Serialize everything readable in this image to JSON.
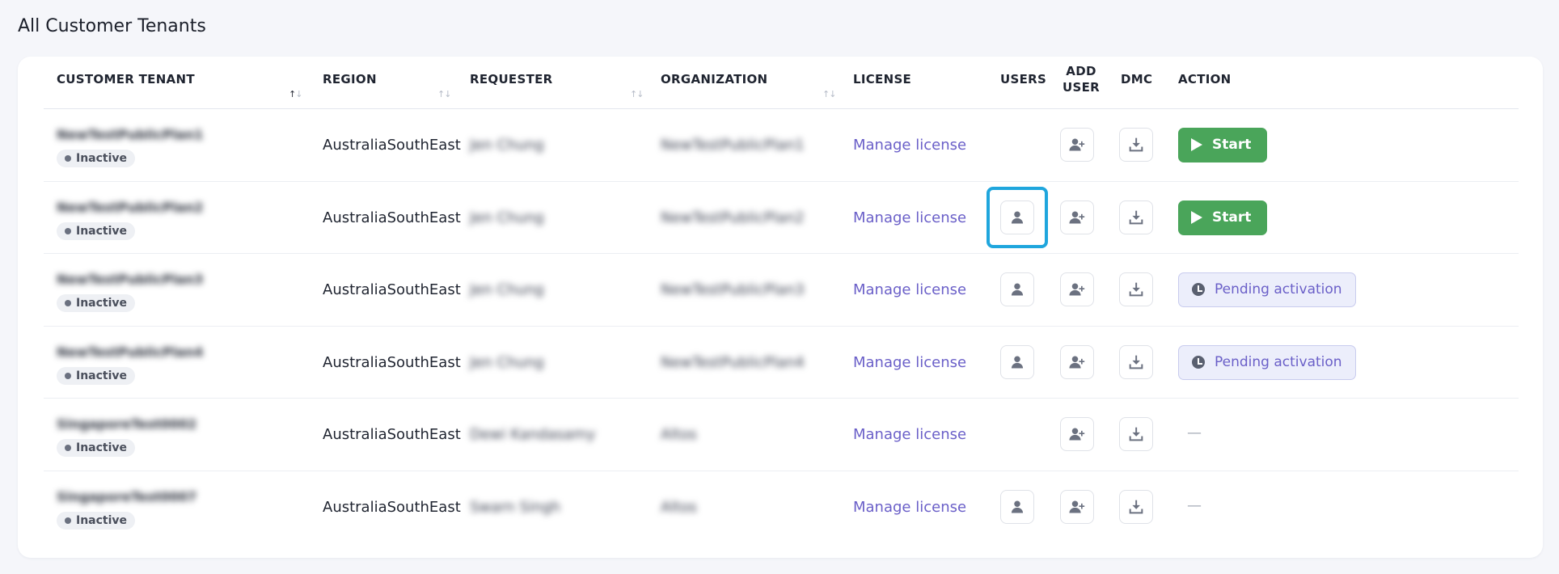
{
  "page": {
    "title": "All Customer Tenants"
  },
  "columns": {
    "customer_tenant": "CUSTOMER TENANT",
    "region": "REGION",
    "requester": "REQUESTER",
    "organization": "ORGANIZATION",
    "license": "LICENSE",
    "users": "USERS",
    "add_user_line1": "ADD",
    "add_user_line2": "USER",
    "dmc": "DMC",
    "action": "ACTION"
  },
  "sort": {
    "up": "↑",
    "down": "↓"
  },
  "rows": [
    {
      "tenant": "NewTestPublicPlan1",
      "status": "Inactive",
      "region": "AustraliaSouthEast",
      "requester": "Jen Chung",
      "organization": "NewTestPublicPlan1",
      "license": "Manage license",
      "show_users": false,
      "action": "start",
      "action_label": "Start"
    },
    {
      "tenant": "NewTestPublicPlan2",
      "status": "Inactive",
      "region": "AustraliaSouthEast",
      "requester": "Jen Chung",
      "organization": "NewTestPublicPlan2",
      "license": "Manage license",
      "show_users": true,
      "focused": true,
      "action": "start",
      "action_label": "Start"
    },
    {
      "tenant": "NewTestPublicPlan3",
      "status": "Inactive",
      "region": "AustraliaSouthEast",
      "requester": "Jen Chung",
      "organization": "NewTestPublicPlan3",
      "license": "Manage license",
      "show_users": true,
      "action": "pending",
      "action_label": "Pending activation"
    },
    {
      "tenant": "NewTestPublicPlan4",
      "status": "Inactive",
      "region": "AustraliaSouthEast",
      "requester": "Jen Chung",
      "organization": "NewTestPublicPlan4",
      "license": "Manage license",
      "show_users": true,
      "action": "pending",
      "action_label": "Pending activation"
    },
    {
      "tenant": "SingaporeTest0002",
      "status": "Inactive",
      "region": "AustraliaSouthEast",
      "requester": "Dewi Kandasamy",
      "organization": "Altos",
      "license": "Manage license",
      "show_users": false,
      "action": "none",
      "action_label": "—"
    },
    {
      "tenant": "SingaporeTest0007",
      "status": "Inactive",
      "region": "AustraliaSouthEast",
      "requester": "Swarn Singh",
      "organization": "Altos",
      "license": "Manage license",
      "show_users": true,
      "action": "none",
      "action_label": "—"
    }
  ],
  "icons": {
    "users": "user-icon",
    "add_user": "user-plus-icon",
    "dmc": "download-icon",
    "start": "play-icon",
    "pending": "clock-icon"
  },
  "colors": {
    "accent": "#6a5fc8",
    "start": "#4aa55a",
    "focus": "#1fa6dd"
  }
}
